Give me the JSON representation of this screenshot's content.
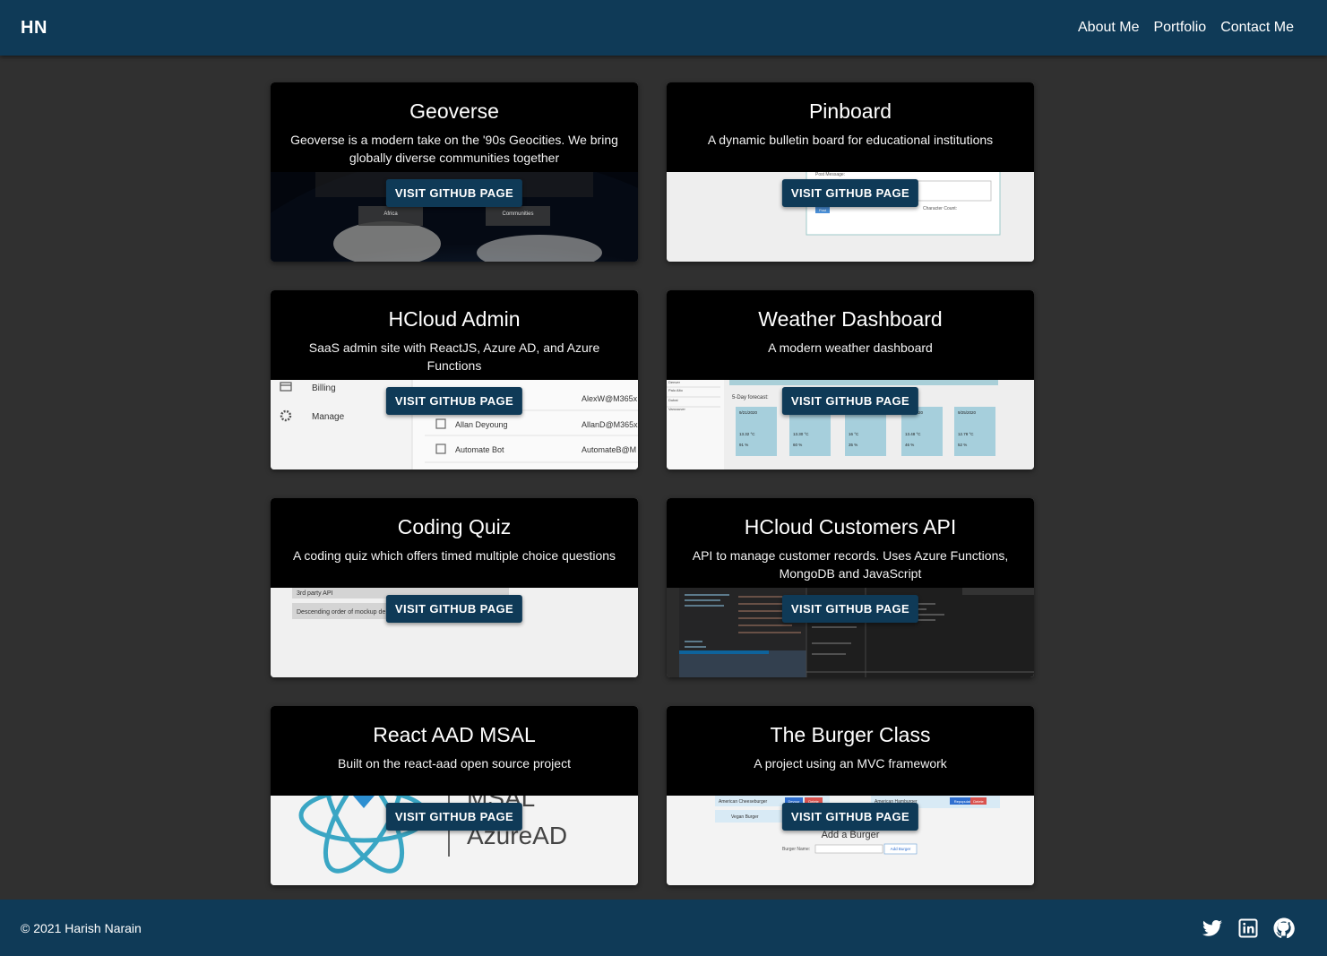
{
  "header": {
    "brand": "HN",
    "nav": [
      "About Me",
      "Portfolio",
      "Contact Me"
    ]
  },
  "projects": [
    {
      "title": "Geoverse",
      "description": "Geoverse is a modern take on the '90s Geocities. We bring globally diverse communities together",
      "button": "VISIT GITHUB PAGE"
    },
    {
      "title": "Pinboard",
      "description": "A dynamic bulletin board for educational institutions",
      "button": "VISIT GITHUB PAGE"
    },
    {
      "title": "HCloud Admin",
      "description": "SaaS admin site with ReactJS, Azure AD, and Azure Functions",
      "button": "VISIT GITHUB PAGE"
    },
    {
      "title": "Weather Dashboard",
      "description": "A modern weather dashboard",
      "button": "VISIT GITHUB PAGE"
    },
    {
      "title": "Coding Quiz",
      "description": "A coding quiz which offers timed multiple choice questions",
      "button": "VISIT GITHUB PAGE"
    },
    {
      "title": "HCloud Customers API",
      "description": "API to manage customer records. Uses Azure Functions, MongoDB and JavaScript",
      "button": "VISIT GITHUB PAGE"
    },
    {
      "title": "React AAD MSAL",
      "description": "Built on the react-aad open source project",
      "button": "VISIT GITHUB PAGE"
    },
    {
      "title": "The Burger Class",
      "description": "A project using an MVC framework",
      "button": "VISIT GITHUB PAGE"
    }
  ],
  "previews": {
    "geoverse": {
      "tab1": "Africa",
      "tab2": "Communities"
    },
    "pinboard": {
      "label1": "Post Message:",
      "button": "Post",
      "label2": "Character Count:"
    },
    "hcloud_admin": {
      "nav": [
        "Billing",
        "Manage"
      ],
      "users": [
        "Allan Deyoung",
        "Automate Bot"
      ],
      "emails": [
        "AlexW@M365x",
        "AllanD@M365x",
        "AutomateB@M"
      ]
    },
    "weather": {
      "cities": [
        "Denver",
        "Palo Alto",
        "Dubai",
        "Vancouver"
      ],
      "forecast_title": "5-Day forecast:",
      "dates": [
        "9/21/2020",
        "9/22/2020",
        "9/23/2020",
        "9/24/2020",
        "9/25/2020"
      ],
      "temps": [
        "13.32 °C",
        "13.30 °C",
        "16 °C",
        "13.48 °C",
        "12.78 °C"
      ],
      "humidity": [
        "91 %",
        "60 %",
        "35 %",
        "46 %",
        "52 %"
      ]
    },
    "quiz": {
      "items": [
        "3rd party API",
        "Descending order of mockup de"
      ]
    },
    "msal": {
      "line1": "MSAL",
      "line2": "AzureAD"
    },
    "burger": {
      "items": [
        "American Cheeseburger",
        "Vegan Burger",
        "American Hamburger"
      ],
      "devour": "Devour",
      "delete": "Delete",
      "repopulate": "Repopulate",
      "add_title": "Add a Burger",
      "name_label": "Burger Name:",
      "add_button": "Add Burger"
    }
  },
  "footer": {
    "copyright": "© 2021 Harish Narain"
  },
  "colors": {
    "primary": "#0f3a57",
    "background": "#303030"
  }
}
